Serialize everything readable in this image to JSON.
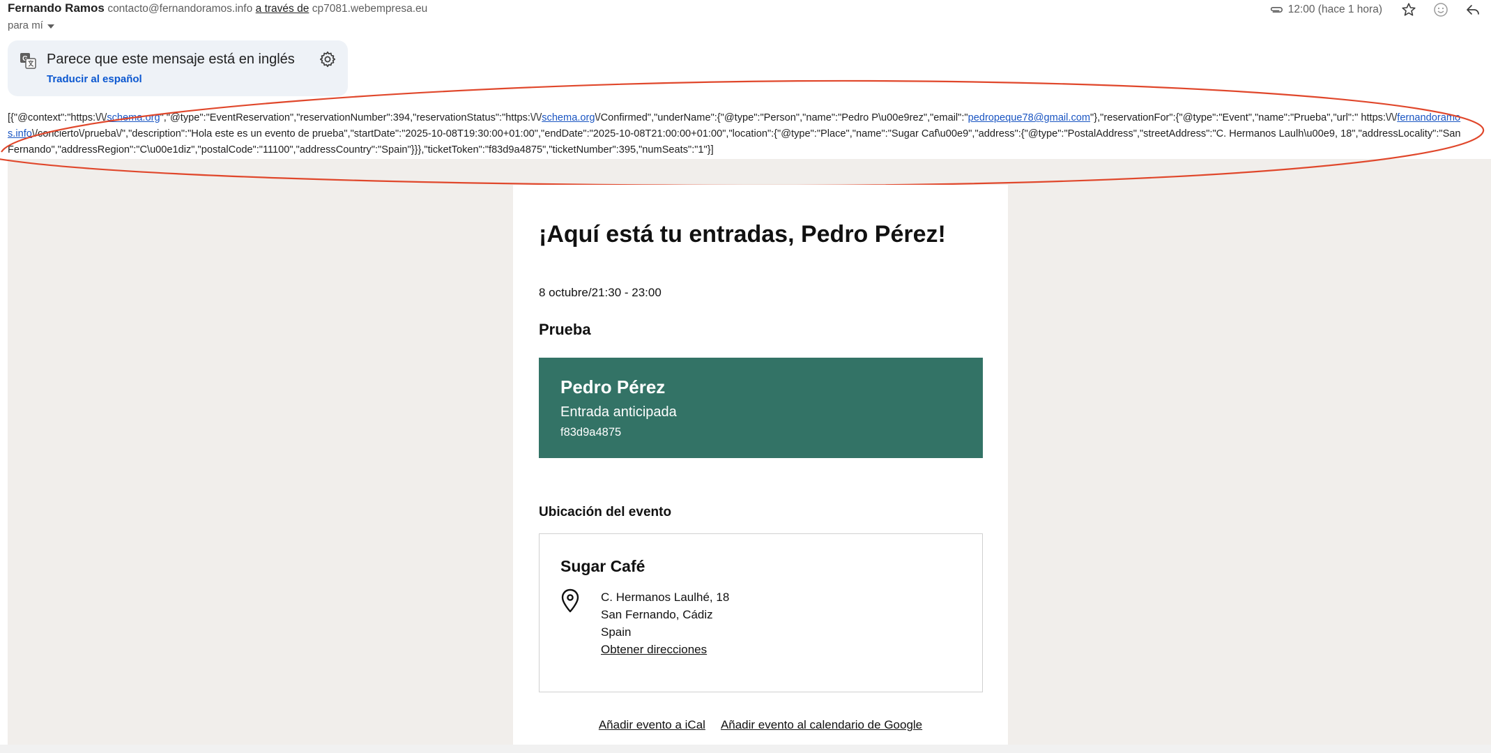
{
  "header": {
    "sender_name": "Fernando Ramos",
    "sender_email": "contacto@fernandoramos.info",
    "via_label": "a través de",
    "via_domain": "cp7081.webempresa.eu",
    "recipient_label": "para mí",
    "time": "12:00 (hace 1 hora)"
  },
  "translate_banner": {
    "message": "Parece que este mensaje está en inglés",
    "link": "Traducir al español"
  },
  "json_ld": {
    "p1": "[{\"@context\":\"https:\\/\\/",
    "l1": "schema.org",
    "p2": "\",\"@type\":\"EventReservation\",\"reservationNumber\":394,\"reservationStatus\":\"https:\\/\\/",
    "l2": "schema.org",
    "p3": "\\/Confirmed\",\"underName\":{\"@type\":\"Person\",\"name\":\"Pedro P\\u00e9rez\",\"email\":\"",
    "l3": "pedropeque78@gmail.com",
    "p4": "\"},\"reservationFor\":{\"@type\":\"Event\",\"name\":\"Prueba\",\"url\":\" https:\\/\\/",
    "l4": "fernandoramos.info",
    "p5": "\\/concierto\\/prueba\\/\",\"description\":\"Hola este es un evento de prueba\",\"startDate\":\"2025-10-08T19:30:00+01:00\",\"endDate\":\"2025-10-08T21:00:00+01:00\",\"location\":{\"@type\":\"Place\",\"name\":\"Sugar Caf\\u00e9\",\"address\":{\"@type\":\"PostalAddress\",\"streetAddress\":\"C. Hermanos Laulh\\u00e9, 18\",\"addressLocality\":\"San Fernando\",\"addressRegion\":\"C\\u00e1diz\",\"postalCode\":\"11100\",\"addressCountry\":\"Spain\"}}},\"ticketToken\":\"f83d9a4875\",\"ticketNumber\":395,\"numSeats\":\"1\"}]"
  },
  "email": {
    "greeting": "¡Aquí está tu entradas, Pedro Pérez!",
    "date": "8 octubre/21:30 - 23:00",
    "event_name": "Prueba",
    "ticket": {
      "holder": "Pedro Pérez",
      "type": "Entrada anticipada",
      "code": "f83d9a4875"
    },
    "location_title": "Ubicación del evento",
    "venue": "Sugar Café",
    "address": {
      "street": "C. Hermanos Laulhé, 18",
      "city": "San Fernando, Cádiz",
      "country": "Spain",
      "directions": "Obtener direcciones"
    },
    "ical_link": "Añadir evento a iCal",
    "gcal_link": "Añadir evento al calendario de Google"
  },
  "colors": {
    "ticket_bg": "#337366",
    "email_bg": "#f1eeeb",
    "annotation": "#e0472b",
    "link": "#1a55c2"
  },
  "icons": [
    "attachment-icon",
    "star-icon",
    "emoji-icon",
    "reply-icon",
    "translate-icon",
    "gear-icon",
    "location-pin-icon",
    "chevron-down-icon"
  ]
}
